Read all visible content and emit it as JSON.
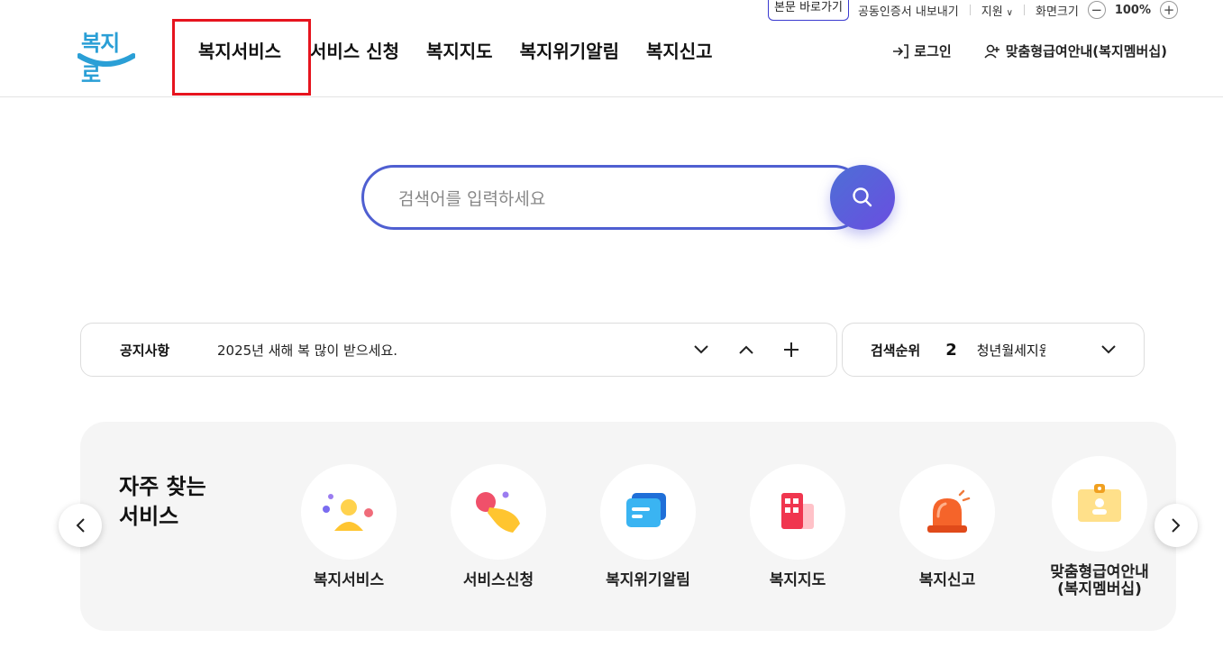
{
  "util": {
    "skip": "본문 바로가기",
    "cert": "공동인증서 내보내기",
    "support": "지원",
    "screen_size": "화면크기",
    "zoom": "100%",
    "minus": "−",
    "plus": "+"
  },
  "header": {
    "logo": "복지로",
    "nav": [
      "복지서비스",
      "서비스 신청",
      "복지지도",
      "복지위기알림",
      "복지신고"
    ],
    "login": "로그인",
    "membership": "맞춤형급여안내(복지멤버십)"
  },
  "search": {
    "placeholder": "검색어를 입력하세요",
    "value": ""
  },
  "notice": {
    "label": "공지사항",
    "message": "2025년 새해 복 많이 받으세요."
  },
  "rank": {
    "label": "검색순위",
    "number": "2",
    "keyword": "청년월세지원"
  },
  "quick": {
    "title_line1": "자주 찾는",
    "title_line2": "서비스",
    "items": [
      {
        "label": "복지서비스",
        "icon": "people-icon"
      },
      {
        "label": "서비스신청",
        "icon": "hand-pointer-icon"
      },
      {
        "label": "복지위기알림",
        "icon": "message-icon"
      },
      {
        "label": "복지지도",
        "icon": "map-building-icon"
      },
      {
        "label": "복지신고",
        "icon": "siren-icon"
      },
      {
        "label": "맞춤형급여안내",
        "label2": "(복지멤버십)",
        "icon": "id-card-icon"
      }
    ]
  },
  "colors": {
    "accent": "#4f5fd1",
    "highlight": "#e6141e",
    "logo": "#2a9fd6"
  }
}
